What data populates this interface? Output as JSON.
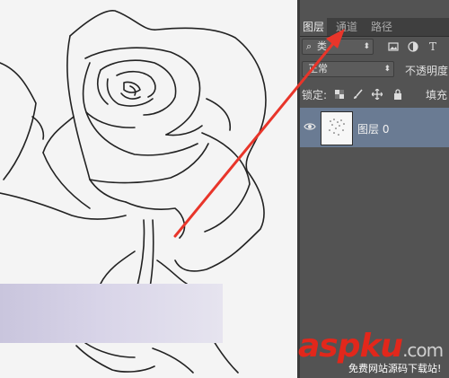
{
  "layers_panel": {
    "tabs": [
      {
        "label": "图层",
        "active": true
      },
      {
        "label": "通道",
        "active": false
      },
      {
        "label": "路径",
        "active": false
      }
    ],
    "kind_filter": {
      "icon": "search-icon",
      "label": "类"
    },
    "filter_icons": [
      "image-filter-icon",
      "adjustment-filter-icon",
      "text-filter-icon"
    ],
    "filter_text_glyph": "T",
    "blend_mode": "正常",
    "opacity_label": "不透明度",
    "lock_label": "锁定:",
    "lock_icons": [
      "lock-transparent-icon",
      "lock-brush-icon",
      "lock-move-icon",
      "lock-all-icon"
    ],
    "fill_label": "填充",
    "layers": [
      {
        "name": "图层 0",
        "visible": true,
        "selected": true
      }
    ],
    "selected_row_color": "#6a7b93"
  },
  "watermark": {
    "logo": "aspku",
    "logo_suffix": ".com",
    "subtitle": "免费网站源码下载站!"
  },
  "annotation": {
    "arrow_color": "#e8352a"
  }
}
